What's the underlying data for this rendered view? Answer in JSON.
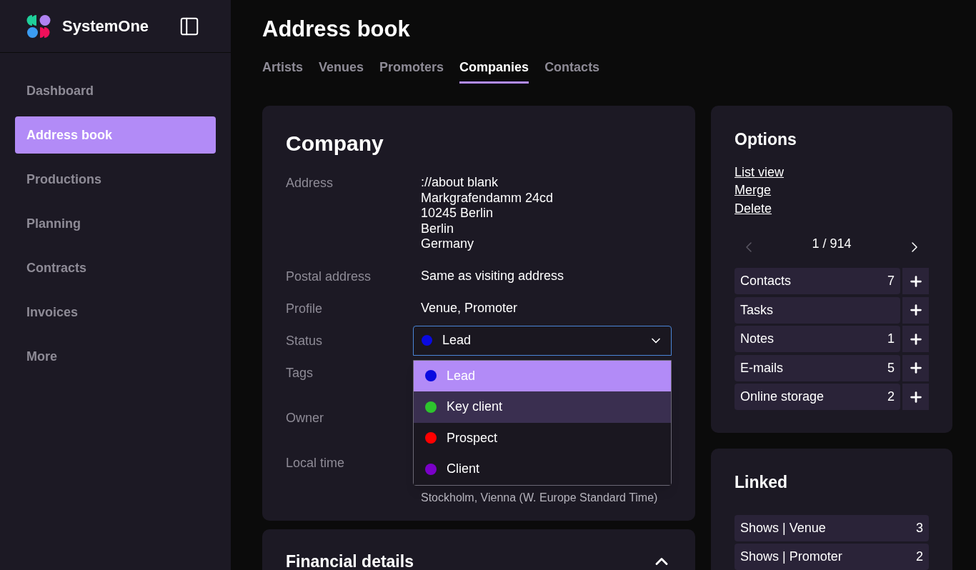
{
  "sidebar": {
    "brand": "SystemOne",
    "items": [
      {
        "label": "Dashboard",
        "selected": false
      },
      {
        "label": "Address book",
        "selected": true
      },
      {
        "label": "Productions",
        "selected": false
      },
      {
        "label": "Planning",
        "selected": false
      },
      {
        "label": "Contracts",
        "selected": false
      },
      {
        "label": "Invoices",
        "selected": false
      },
      {
        "label": "More",
        "selected": false
      }
    ]
  },
  "page": {
    "title": "Address book",
    "tabs": [
      {
        "label": "Artists",
        "selected": false
      },
      {
        "label": "Venues",
        "selected": false
      },
      {
        "label": "Promoters",
        "selected": false
      },
      {
        "label": "Companies",
        "selected": true
      },
      {
        "label": "Contacts",
        "selected": false
      }
    ]
  },
  "company": {
    "title": "Company",
    "fields": [
      {
        "kind": "text",
        "label": "Address",
        "lines": [
          "://about blank",
          "Markgrafendamm 24cd",
          "10245 Berlin",
          "Berlin",
          "Germany"
        ]
      },
      {
        "kind": "text",
        "label": "Postal address",
        "lines": [
          "Same as visiting address"
        ]
      },
      {
        "kind": "text",
        "label": "Profile",
        "lines": [
          "Venue, Promoter"
        ]
      },
      {
        "kind": "select",
        "label": "Status",
        "value": "Lead",
        "color": "#0a0ae0",
        "expanded": true,
        "options": [
          {
            "label": "Lead",
            "color": "#0a0ae0",
            "selected": true,
            "highlighted": false
          },
          {
            "label": "Key client",
            "color": "#2dc42d",
            "selected": false,
            "highlighted": true
          },
          {
            "label": "Prospect",
            "color": "#ff0000",
            "selected": false,
            "highlighted": false
          },
          {
            "label": "Client",
            "color": "#7a00c8",
            "selected": false,
            "highlighted": false
          }
        ]
      },
      {
        "kind": "covered",
        "label": "Tags"
      },
      {
        "kind": "covered",
        "label": "Owner"
      },
      {
        "kind": "time",
        "label": "Local time",
        "lines": [
          "Stockholm, Vienna (W. Europe Standard Time)"
        ]
      }
    ]
  },
  "financial": {
    "title": "Financial details",
    "expanded": true
  },
  "options": {
    "title": "Options",
    "links": [
      "List view",
      "Merge",
      "Delete"
    ],
    "pager": {
      "text": "1 / 914",
      "prev_disabled": true,
      "next_disabled": false
    },
    "counters": [
      {
        "label": "Contacts",
        "count": "7"
      },
      {
        "label": "Tasks"
      },
      {
        "label": "Notes",
        "count": "1"
      },
      {
        "label": "E-mails",
        "count": "5"
      },
      {
        "label": "Online storage",
        "count": "2"
      }
    ]
  },
  "linked": {
    "title": "Linked",
    "items": [
      {
        "label": "Shows | Venue",
        "count": "3"
      },
      {
        "label": "Shows | Promoter",
        "count": "2"
      }
    ]
  }
}
